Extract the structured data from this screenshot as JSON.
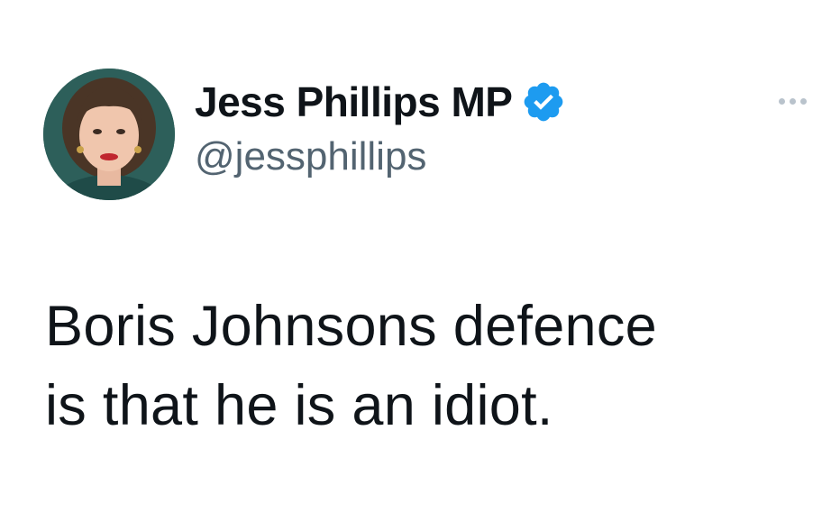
{
  "tweet": {
    "author": {
      "display_name": "Jess Phillips MP",
      "handle": "@jessphillips",
      "verified": true,
      "avatar_icon": "profile-photo",
      "verified_icon": "verified-badge-icon"
    },
    "text_line1": "Boris Johnsons defence",
    "text_line2": "is that he is an idiot.",
    "more_icon": "more-options-icon"
  },
  "colors": {
    "text_primary": "#0f1419",
    "text_secondary": "#536471",
    "verified_blue": "#1d9bf0",
    "background": "#ffffff"
  }
}
